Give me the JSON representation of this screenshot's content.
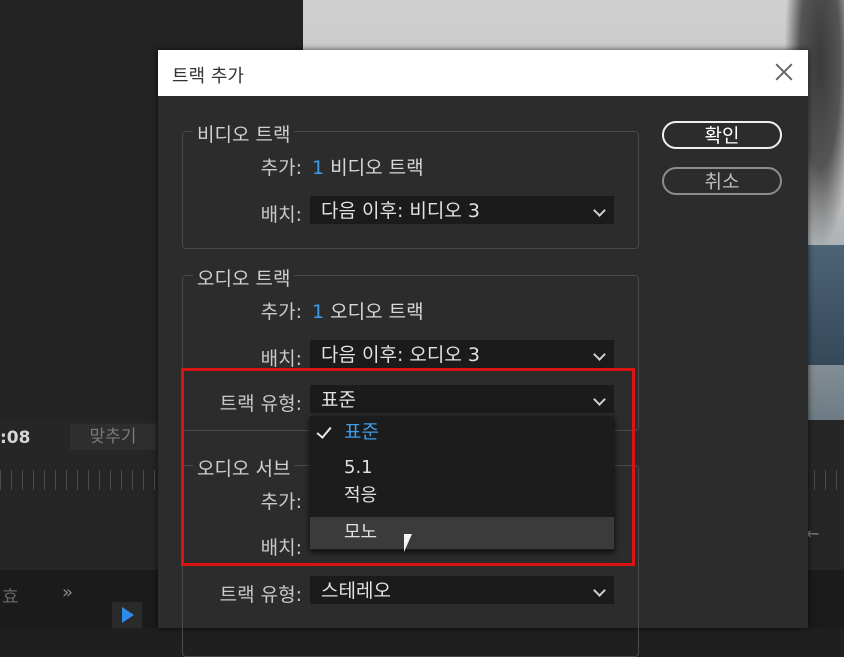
{
  "background": {
    "timecode": ":08",
    "fit_button": "맞추기",
    "bottom_label": "효",
    "chevrons": "»",
    "right_arrow": "←"
  },
  "dialog": {
    "title": "트랙 추가",
    "buttons": {
      "ok": "확인",
      "cancel": "취소"
    },
    "video": {
      "group_title": "비디오 트랙",
      "add_label": "추가:",
      "add_count": "1",
      "add_unit": "비디오 트랙",
      "placement_label": "배치:",
      "placement_value": "다음 이후: 비디오 3"
    },
    "audio": {
      "group_title": "오디오 트랙",
      "add_label": "추가:",
      "add_count": "1",
      "add_unit": "오디오 트랙",
      "placement_label": "배치:",
      "placement_value": "다음 이후: 오디오 3",
      "type_label": "트랙 유형:",
      "type_value": "표준"
    },
    "submix": {
      "group_title": "오디오 서브",
      "add_label": "추가:",
      "placement_label": "배치:",
      "type_label": "트랙 유형:",
      "type_value": "스테레오"
    },
    "dropdown": {
      "options": [
        "표준",
        "5.1",
        "적응",
        "모노"
      ],
      "selected": "표준",
      "hovered": "모노"
    }
  },
  "colors": {
    "accent": "#3d9be9",
    "highlight": "#d81414"
  }
}
